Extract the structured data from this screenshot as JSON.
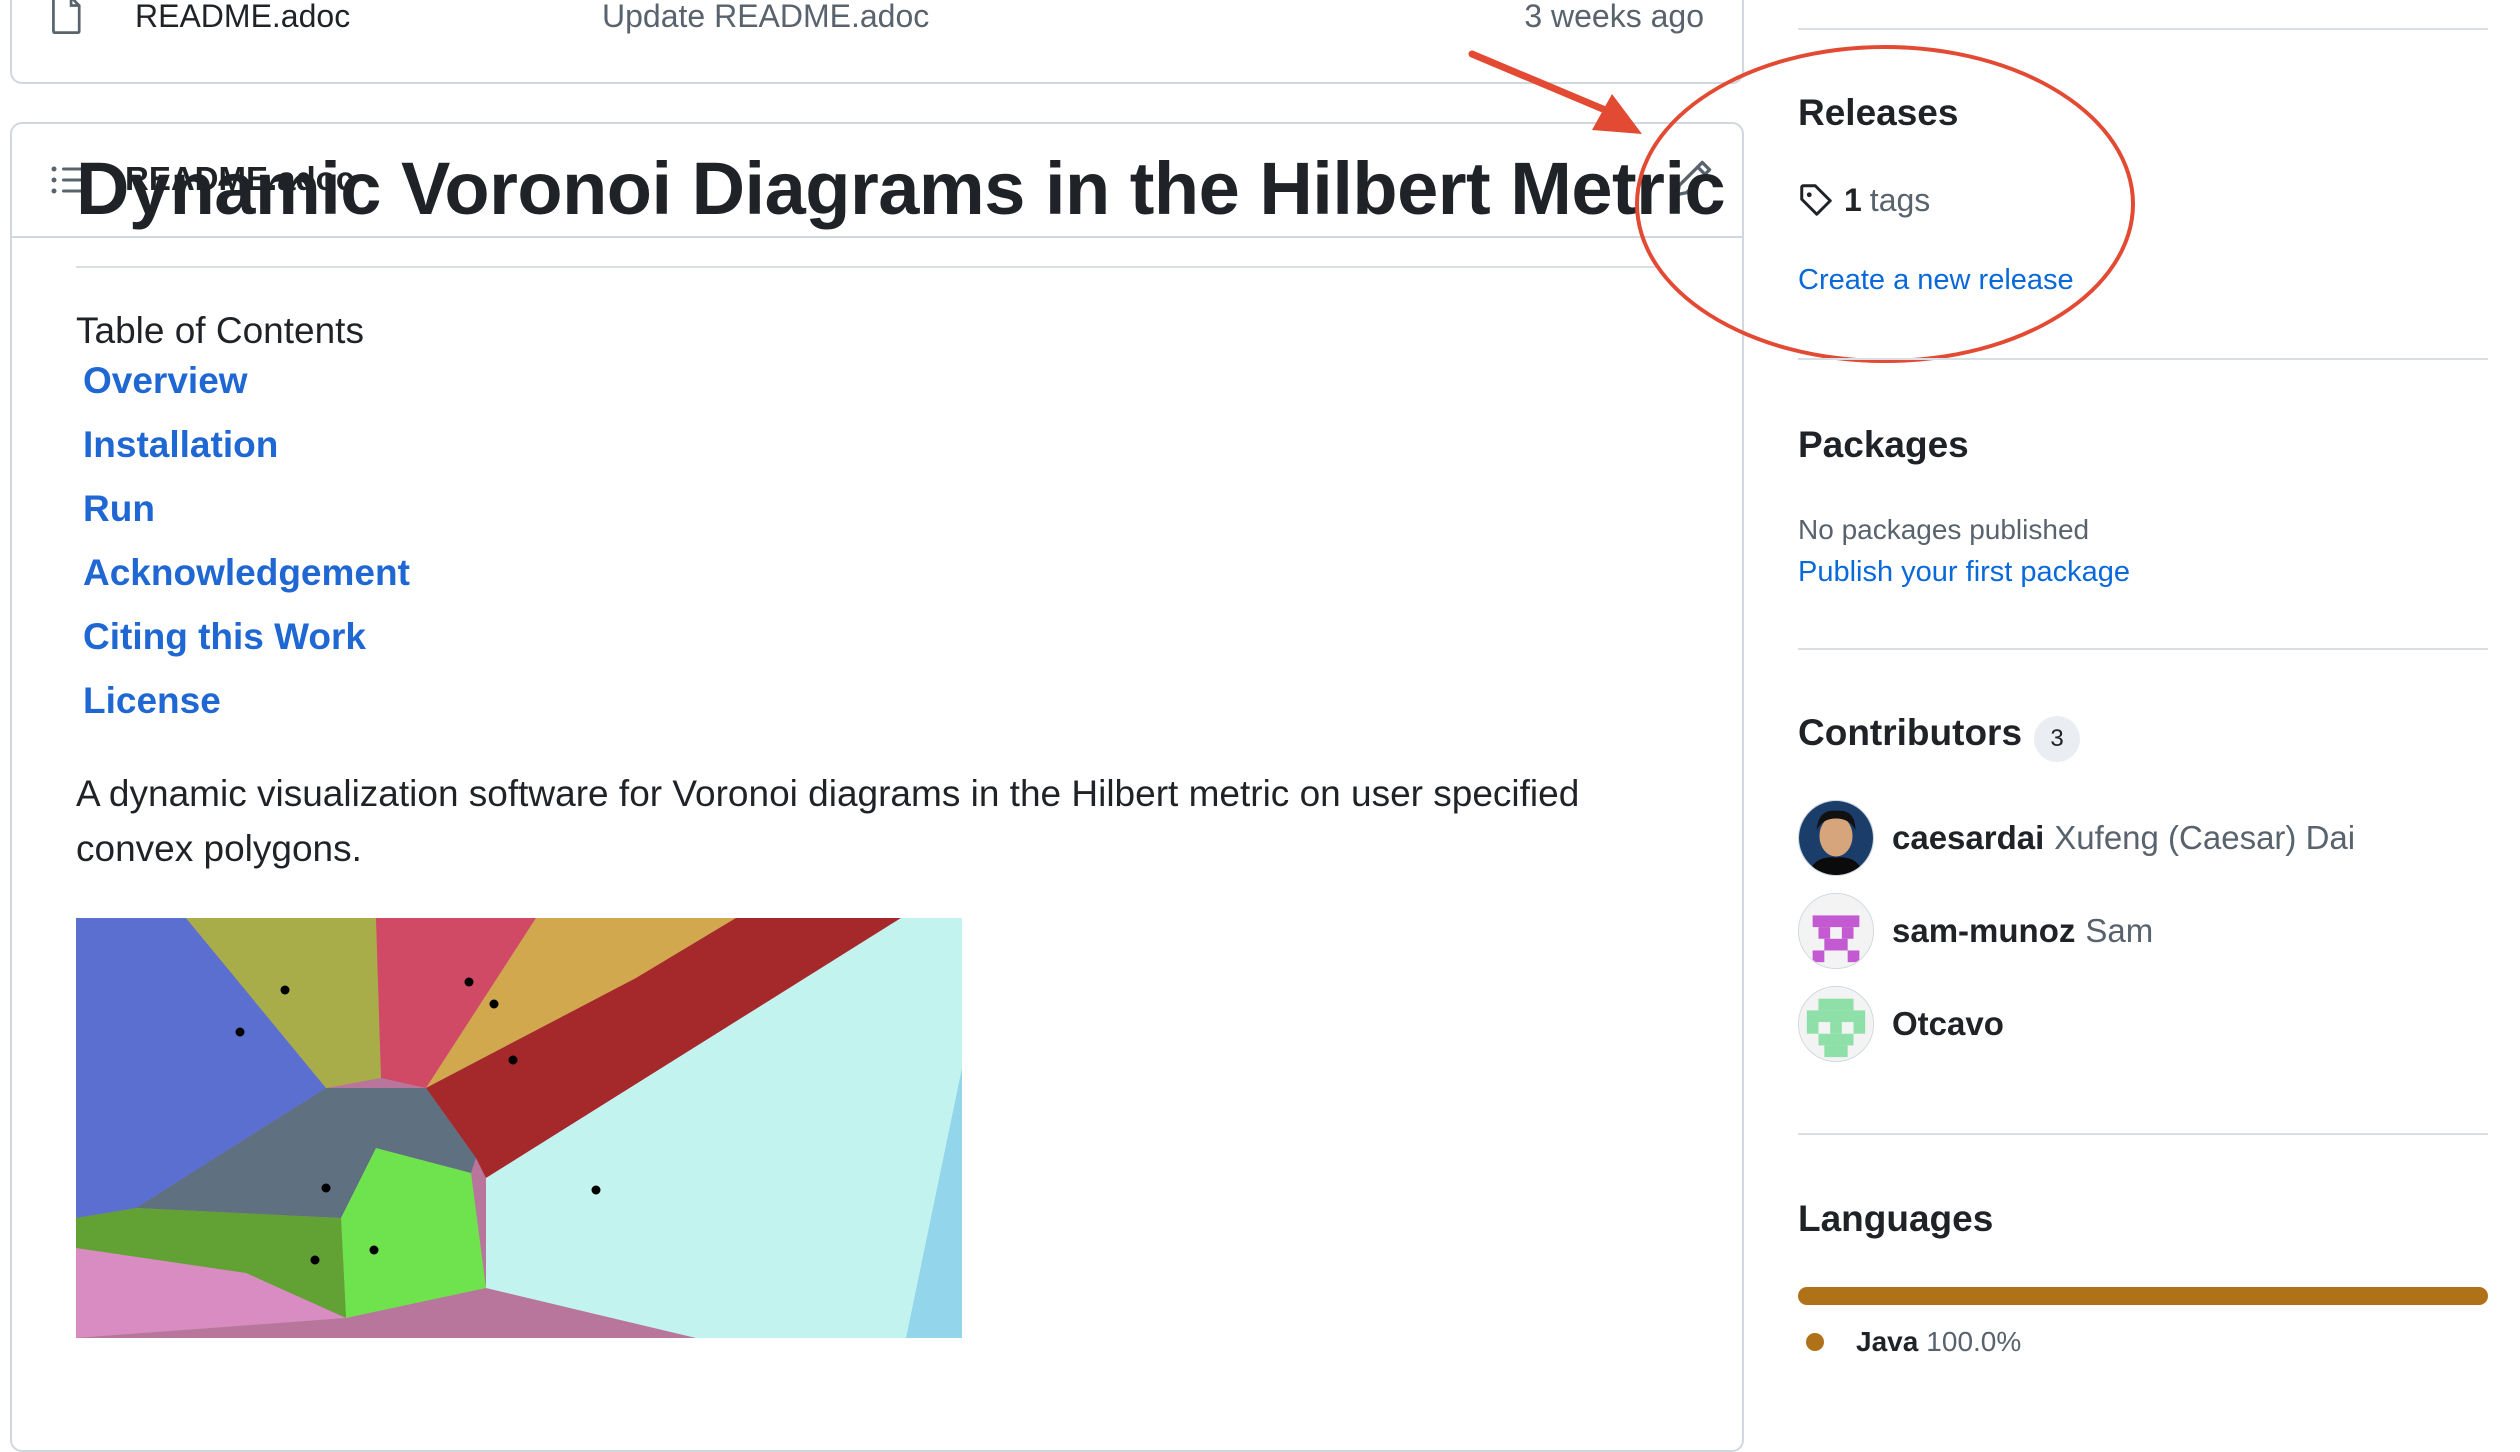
{
  "file_row": {
    "name": "README.adoc",
    "commit": "Update README.adoc",
    "age": "3 weeks ago"
  },
  "readme": {
    "header_title": "README.adoc",
    "doc_title": "Dynamic Voronoi Diagrams in the Hilbert Metric",
    "toc_title": "Table of Contents",
    "toc_items": [
      "Overview",
      "Installation",
      "Run",
      "Acknowledgement",
      "Citing this Work",
      "License"
    ],
    "description": "A dynamic visualization software for Voronoi diagrams in the Hilbert metric on user specified convex polygons."
  },
  "sidebar": {
    "releases": {
      "heading": "Releases",
      "tag_count": "1",
      "tag_label": "tags",
      "create_link": "Create a new release"
    },
    "packages": {
      "heading": "Packages",
      "status": "No packages published",
      "publish_link": "Publish your first package"
    },
    "contributors": {
      "heading": "Contributors",
      "count": "3",
      "people": [
        {
          "login": "caesardai",
          "name": "Xufeng (Caesar) Dai"
        },
        {
          "login": "sam-munoz",
          "name": "Sam"
        },
        {
          "login": "Otcavo",
          "name": ""
        }
      ]
    },
    "languages": {
      "heading": "Languages",
      "items": [
        {
          "name": "Java",
          "percent": "100.0%",
          "color": "#b07219"
        }
      ]
    }
  },
  "colors": {
    "link": "#0969da",
    "annotation": "#e34a33"
  },
  "icons": [
    "file-icon",
    "list-icon",
    "pencil-icon",
    "tag-icon"
  ]
}
